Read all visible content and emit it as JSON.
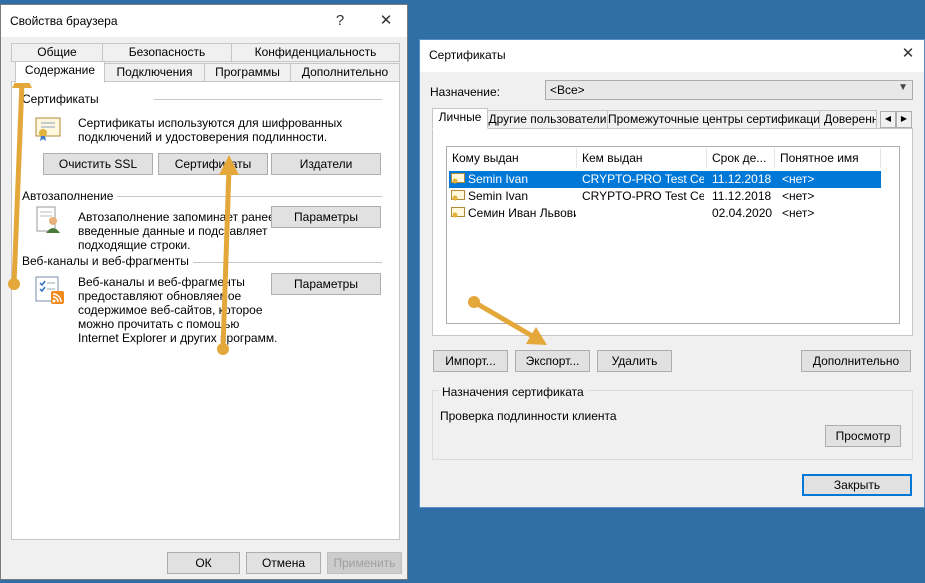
{
  "browser": {
    "title": "Свойства браузера",
    "help_glyph": "?",
    "close_glyph": "✕",
    "tabs_back": [
      "Общие",
      "Безопасность",
      "Конфиденциальность"
    ],
    "tabs_front": [
      "Содержание",
      "Подключения",
      "Программы",
      "Дополнительно"
    ],
    "certs": {
      "heading": "Сертификаты",
      "desc": [
        "Сертификаты используются для шифрованных",
        "подключений и удостоверения подлинности."
      ],
      "btn_ssl": "Очистить SSL",
      "btn_certs": "Сертификаты",
      "btn_publishers": "Издатели"
    },
    "autofill": {
      "heading": "Автозаполнение",
      "desc": [
        "Автозаполнение запоминает ранее",
        "введенные данные и подставляет",
        "подходящие строки."
      ],
      "btn": "Параметры"
    },
    "feeds": {
      "heading": "Веб-каналы и веб-фрагменты",
      "desc": [
        "Веб-каналы и веб-фрагменты",
        "предоставляют обновляемое",
        "содержимое веб-сайтов, которое",
        "можно прочитать с помощью",
        "Internet Explorer и других программ."
      ],
      "btn": "Параметры"
    },
    "footer": {
      "ok": "ОК",
      "cancel": "Отмена",
      "apply": "Применить"
    }
  },
  "certificates": {
    "title": "Сертификаты",
    "close_glyph": "✕",
    "purpose_label": "Назначение:",
    "purpose_value": "<Все>",
    "tabs": [
      "Личные",
      "Другие пользователи",
      "Промежуточные центры сертификации",
      "Доверенны"
    ],
    "columns": [
      "Кому выдан",
      "Кем выдан",
      "Срок де...",
      "Понятное имя"
    ],
    "rows": [
      {
        "to": "Semin Ivan",
        "by": "CRYPTO-PRO Test Ce...",
        "exp": "11.12.2018",
        "name": "<нет>",
        "selected": true
      },
      {
        "to": "Semin Ivan",
        "by": "CRYPTO-PRO Test Ce...",
        "exp": "11.12.2018",
        "name": "<нет>",
        "selected": false
      },
      {
        "to": "Семин Иван Львович",
        "by": "",
        "exp": "02.04.2020",
        "name": "<нет>",
        "selected": false
      }
    ],
    "btn_import": "Импорт...",
    "btn_export": "Экспорт...",
    "btn_delete": "Удалить",
    "btn_advanced": "Дополнительно",
    "purposes_heading": "Назначения сертификата",
    "purposes_value": "Проверка подлинности клиента",
    "btn_view": "Просмотр",
    "btn_close": "Закрыть"
  },
  "colors": {
    "desktop": "#2f6fa5",
    "accent": "#0078d7",
    "arrow": "#e3a73a"
  }
}
